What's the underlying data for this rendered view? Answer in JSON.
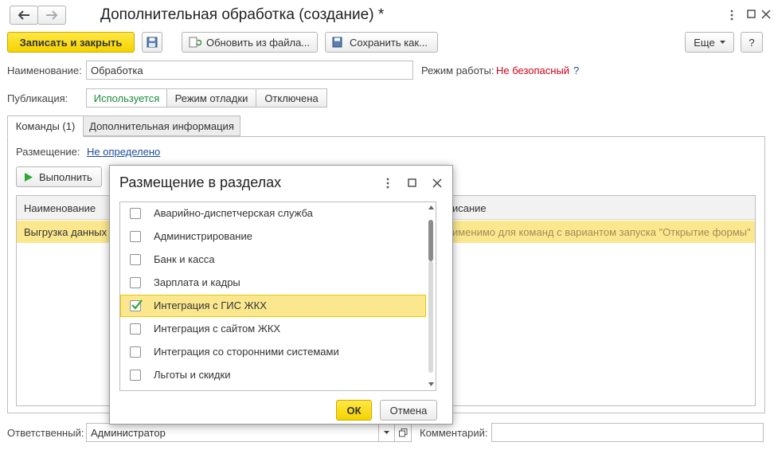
{
  "window": {
    "title": "Дополнительная обработка (создание) *",
    "nav_back_icon": "arrow-left-icon",
    "nav_forward_icon": "arrow-right-icon"
  },
  "toolbar": {
    "save_close_label": "Записать и закрыть",
    "save_icon": "floppy-disk-icon",
    "update_from_file_label": "Обновить из файла...",
    "save_as_label": "Сохранить как...",
    "more_label": "Еще",
    "help_label": "?"
  },
  "form": {
    "name_label": "Наименование:",
    "name_value": "Обработка",
    "mode_label": "Режим работы:",
    "mode_value": "Не безопасный",
    "mode_help": "?",
    "publication_label": "Публикация:",
    "publication_options": [
      "Используется",
      "Режим отладки",
      "Отключена"
    ],
    "publication_selected": "Используется",
    "responsible_label": "Ответственный:",
    "responsible_value": "Администратор",
    "comment_label": "Комментарий:",
    "comment_value": ""
  },
  "tabs": [
    {
      "label": "Команды (1)",
      "active": true
    },
    {
      "label": "Дополнительная информация",
      "active": false
    }
  ],
  "commands": {
    "placement_label": "Размещение:",
    "placement_value": "Не определено",
    "run_label": "Выполнить",
    "table": {
      "columns": [
        "Наименование",
        "Описание"
      ],
      "visible_header_fragment": "исание",
      "rows": [
        {
          "name": "Выгрузка данных",
          "description_fragment": "именимо для команд с вариантом запуска \"Открытие формы\""
        }
      ]
    }
  },
  "dialog": {
    "title": "Размещение в разделах",
    "items": [
      {
        "label": "Аварийно-диспетчерская служба",
        "checked": false
      },
      {
        "label": "Администрирование",
        "checked": false
      },
      {
        "label": "Банк и касса",
        "checked": false
      },
      {
        "label": "Зарплата и кадры",
        "checked": false
      },
      {
        "label": "Интеграция с ГИС ЖКХ",
        "checked": true
      },
      {
        "label": "Интеграция с сайтом ЖКХ",
        "checked": false
      },
      {
        "label": "Интеграция со сторонними системами",
        "checked": false
      },
      {
        "label": "Льготы и скидки",
        "checked": false
      }
    ],
    "ok_label": "ОК",
    "cancel_label": "Отмена"
  },
  "colors": {
    "accent_yellow": "#f5d300",
    "selection": "#fbe78e",
    "link": "#1b4c9b",
    "danger": "#d0021b",
    "active_green": "#1c8a3a"
  }
}
